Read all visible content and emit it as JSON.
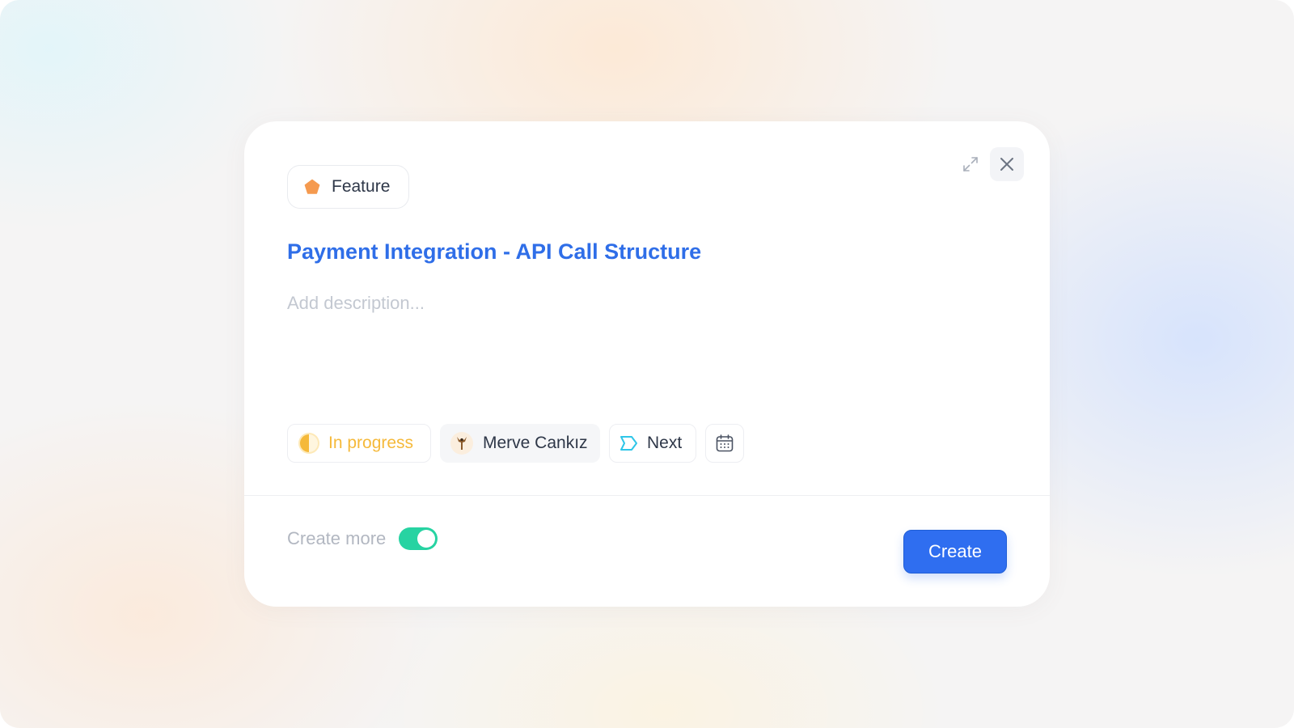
{
  "issue_type": {
    "label": "Feature",
    "icon": "pentagon-icon",
    "color": "#f59a4f"
  },
  "title": "Payment Integration - API Call Structure",
  "description": {
    "placeholder": "Add description..."
  },
  "properties": {
    "status": {
      "label": "In progress",
      "icon": "half-circle-icon",
      "color": "#f5b93a"
    },
    "assignee": {
      "name": "Merve Cankız",
      "icon": "avatar"
    },
    "cycle": {
      "label": "Next",
      "icon": "cycle-tag-icon",
      "color": "#2fc6e8"
    },
    "due_date": {
      "icon": "calendar-icon"
    }
  },
  "footer": {
    "create_more_label": "Create more",
    "create_more_enabled": true,
    "create_button_label": "Create"
  },
  "colors": {
    "accent": "#2f6ef0",
    "toggle_on": "#27d3a2",
    "title": "#2f6ee8"
  }
}
